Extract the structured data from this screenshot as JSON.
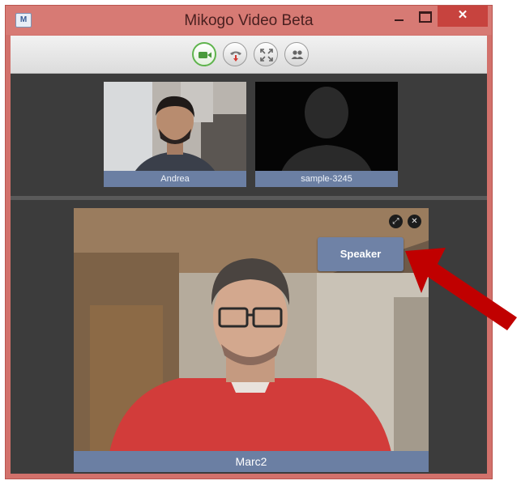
{
  "window": {
    "title": "Mikogo Video Beta",
    "icon": "app-icon",
    "close_symbol": "✕"
  },
  "toolbar": {
    "buttons": [
      {
        "name": "video-camera-icon",
        "active": true
      },
      {
        "name": "hang-up-icon",
        "active": false
      },
      {
        "name": "fullscreen-icon",
        "active": false
      },
      {
        "name": "participants-icon",
        "active": false
      }
    ]
  },
  "thumbnails": [
    {
      "label": "Andrea"
    },
    {
      "label": "sample-3245"
    }
  ],
  "main_video": {
    "label": "Marc2",
    "speaker_label": "Speaker",
    "expand_symbol": "⤢",
    "close_symbol": "✕"
  },
  "colors": {
    "window_frame": "#d2716b",
    "close_button": "#c7433e",
    "label_bar": "#6b7fa3",
    "active_button": "#5fb44d",
    "annotation_arrow": "#c00000"
  }
}
